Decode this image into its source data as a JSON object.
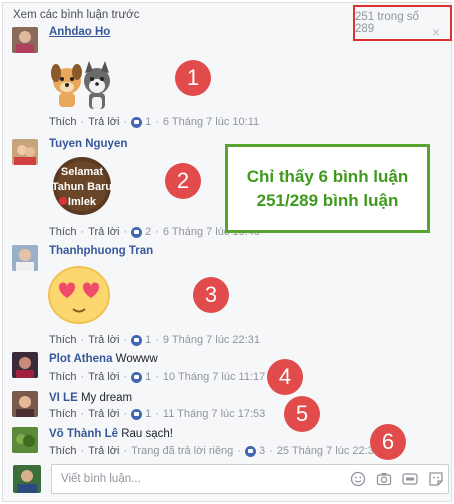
{
  "header": {
    "view_previous": "Xem các bình luận trước",
    "count": "251 trong số 289",
    "close": "×"
  },
  "note": {
    "line1": "Chỉ thấy 6 bình luận",
    "line2": "251/289 bình luận"
  },
  "comments": [
    {
      "name": "Anhdao Ho",
      "text": "",
      "like": "Thích",
      "reply": "Trả lời",
      "likes": "1",
      "time": "6 Tháng 7 lúc 10:11",
      "marker": "1",
      "sticker": "dog-cat-sticker"
    },
    {
      "name": "Tuyen Nguyen",
      "text": "",
      "like": "Thích",
      "reply": "Trả lời",
      "likes": "2",
      "time": "6 Tháng 7 lúc 10:40",
      "marker": "2",
      "sticker": "selamat-tahun-baru-imlek-sticker",
      "sticker_text": [
        "Selamat",
        "Tahun Baru",
        "Imlek"
      ]
    },
    {
      "name": "Thanhphuong Tran",
      "text": "",
      "like": "Thích",
      "reply": "Trả lời",
      "likes": "1",
      "time": "9 Tháng 7 lúc 22:31",
      "marker": "3",
      "sticker": "heart-eyes-emoji-sticker"
    },
    {
      "name": "Plot Athena",
      "text": "Wowww",
      "like": "Thích",
      "reply": "Trả lời",
      "likes": "1",
      "time": "10 Tháng 7 lúc 11:17",
      "marker": "4"
    },
    {
      "name": "VI LE",
      "text": "My dream",
      "like": "Thích",
      "reply": "Trả lời",
      "likes": "1",
      "time": "11 Tháng 7 lúc 17:53",
      "marker": "5"
    },
    {
      "name": "Võ Thành Lê",
      "text": "Rau sạch!",
      "like": "Thích",
      "reply": "Trả lời",
      "extra": "Trang đã trả lời riêng",
      "likes": "3",
      "time": "25 Tháng 7 lúc 22:37",
      "marker": "6"
    }
  ],
  "reply_box": {
    "placeholder": "Viết bình luận..."
  },
  "icons": {
    "like": "like-icon",
    "emoji": "smiley-icon",
    "camera": "camera-icon",
    "gif": "gif-icon",
    "sticker": "sticker-icon"
  },
  "colors": {
    "accent": "#365899",
    "marker": "#e24b4b",
    "note": "#57a42e",
    "count_box": "#e03131"
  }
}
